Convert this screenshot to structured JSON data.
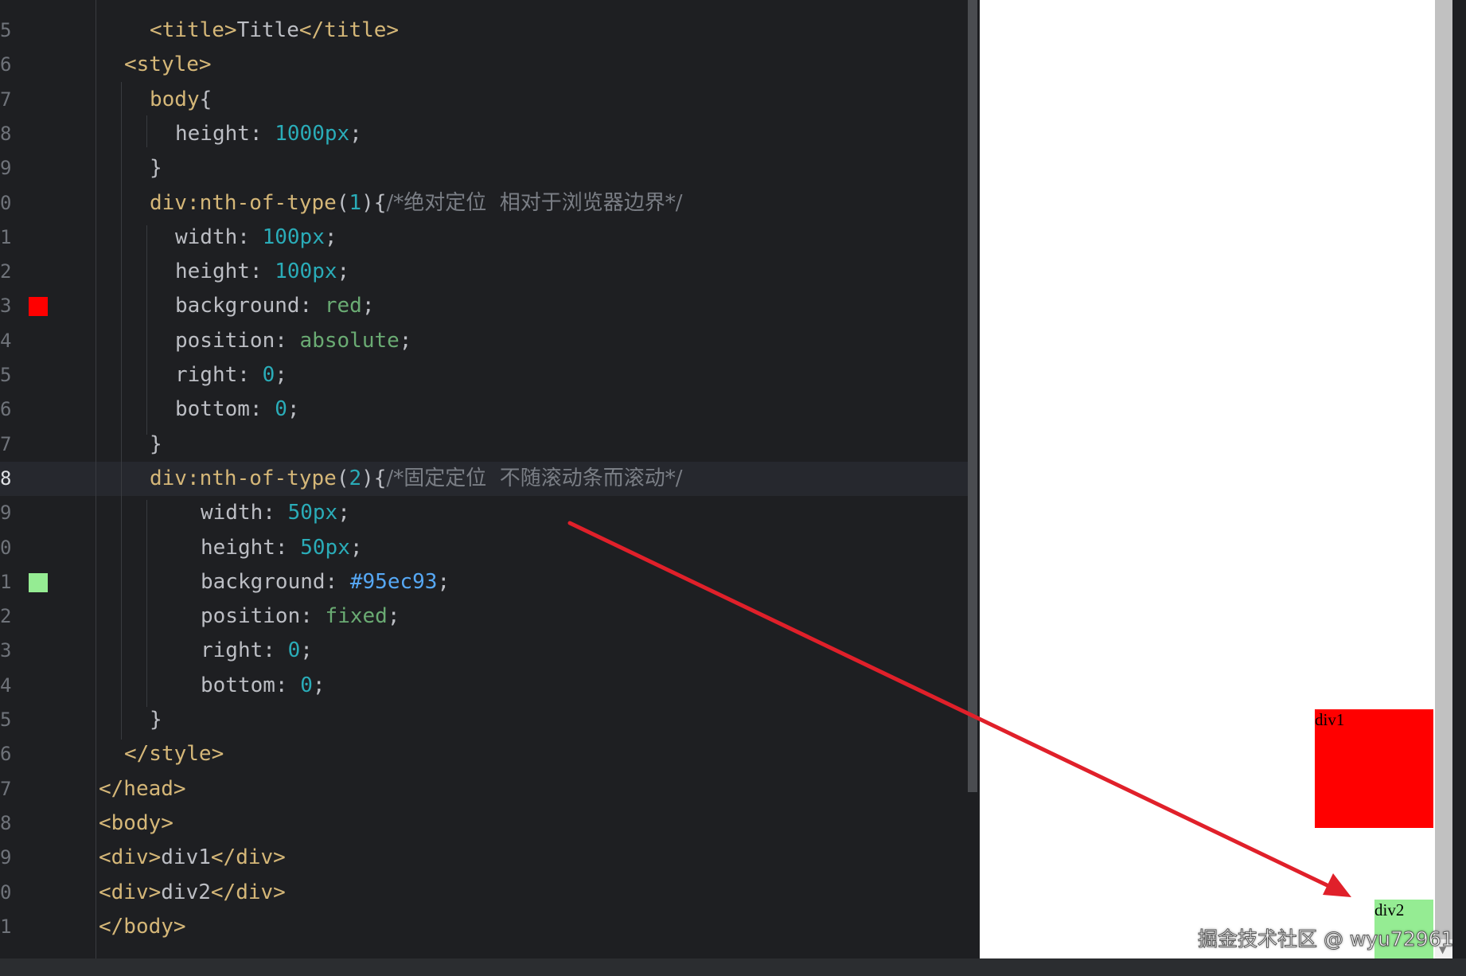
{
  "editor": {
    "lines": [
      {
        "no": "5",
        "tokens": [
          {
            "c": "tag",
            "t": "<title>"
          },
          {
            "c": "txt",
            "t": "Title"
          },
          {
            "c": "tag",
            "t": "</title>"
          }
        ],
        "indent": 188
      },
      {
        "no": "6",
        "tokens": [
          {
            "c": "tag",
            "t": "<style>"
          }
        ],
        "indent": 156
      },
      {
        "no": "7",
        "tokens": [
          {
            "c": "sel",
            "t": "body"
          },
          {
            "c": "punc",
            "t": "{"
          }
        ],
        "indent": 188
      },
      {
        "no": "8",
        "tokens": [
          {
            "c": "prop",
            "t": "height"
          },
          {
            "c": "punc",
            "t": ": "
          },
          {
            "c": "num",
            "t": "1000px"
          },
          {
            "c": "punc",
            "t": ";"
          }
        ],
        "indent": 220
      },
      {
        "no": "9",
        "tokens": [
          {
            "c": "punc",
            "t": "}"
          }
        ],
        "indent": 188
      },
      {
        "no": "0",
        "tokens": [
          {
            "c": "sel",
            "t": "div:nth-of-type"
          },
          {
            "c": "punc",
            "t": "("
          },
          {
            "c": "num",
            "t": "1"
          },
          {
            "c": "punc",
            "t": "){"
          },
          {
            "c": "cmt",
            "t": "/*绝对定位  相对于浏览器边界*/"
          }
        ],
        "indent": 188
      },
      {
        "no": "1",
        "tokens": [
          {
            "c": "prop",
            "t": "width"
          },
          {
            "c": "punc",
            "t": ": "
          },
          {
            "c": "num",
            "t": "100px"
          },
          {
            "c": "punc",
            "t": ";"
          }
        ],
        "indent": 220
      },
      {
        "no": "2",
        "tokens": [
          {
            "c": "prop",
            "t": "height"
          },
          {
            "c": "punc",
            "t": ": "
          },
          {
            "c": "num",
            "t": "100px"
          },
          {
            "c": "punc",
            "t": ";"
          }
        ],
        "indent": 220
      },
      {
        "no": "3",
        "swatch": "#ff0000",
        "tokens": [
          {
            "c": "prop",
            "t": "background"
          },
          {
            "c": "punc",
            "t": ": "
          },
          {
            "c": "kw",
            "t": "red"
          },
          {
            "c": "punc",
            "t": ";"
          }
        ],
        "indent": 220
      },
      {
        "no": "4",
        "tokens": [
          {
            "c": "prop",
            "t": "position"
          },
          {
            "c": "punc",
            "t": ": "
          },
          {
            "c": "kw",
            "t": "absolute"
          },
          {
            "c": "punc",
            "t": ";"
          }
        ],
        "indent": 220
      },
      {
        "no": "5",
        "tokens": [
          {
            "c": "prop",
            "t": "right"
          },
          {
            "c": "punc",
            "t": ": "
          },
          {
            "c": "num",
            "t": "0"
          },
          {
            "c": "punc",
            "t": ";"
          }
        ],
        "indent": 220
      },
      {
        "no": "6",
        "tokens": [
          {
            "c": "prop",
            "t": "bottom"
          },
          {
            "c": "punc",
            "t": ": "
          },
          {
            "c": "num",
            "t": "0"
          },
          {
            "c": "punc",
            "t": ";"
          }
        ],
        "indent": 220
      },
      {
        "no": "7",
        "tokens": [
          {
            "c": "punc",
            "t": "}"
          }
        ],
        "indent": 188
      },
      {
        "no": "8",
        "current": true,
        "tokens": [
          {
            "c": "sel",
            "t": "div:nth-of-type"
          },
          {
            "c": "punc",
            "t": "("
          },
          {
            "c": "num",
            "t": "2"
          },
          {
            "c": "punc",
            "t": "){"
          },
          {
            "c": "cmt",
            "t": "/*固定定位  不随滚动条而滚动*/"
          }
        ],
        "indent": 188
      },
      {
        "no": "9",
        "tokens": [
          {
            "c": "prop",
            "t": "width"
          },
          {
            "c": "punc",
            "t": ": "
          },
          {
            "c": "num",
            "t": "50px"
          },
          {
            "c": "punc",
            "t": ";"
          }
        ],
        "indent": 252
      },
      {
        "no": "0",
        "tokens": [
          {
            "c": "prop",
            "t": "height"
          },
          {
            "c": "punc",
            "t": ": "
          },
          {
            "c": "num",
            "t": "50px"
          },
          {
            "c": "punc",
            "t": ";"
          }
        ],
        "indent": 252
      },
      {
        "no": "1",
        "swatch": "#95ec93",
        "tokens": [
          {
            "c": "prop",
            "t": "background"
          },
          {
            "c": "punc",
            "t": ": "
          },
          {
            "c": "hex",
            "t": "#95ec93"
          },
          {
            "c": "punc",
            "t": ";"
          }
        ],
        "indent": 252
      },
      {
        "no": "2",
        "tokens": [
          {
            "c": "prop",
            "t": "position"
          },
          {
            "c": "punc",
            "t": ": "
          },
          {
            "c": "kw",
            "t": "fixed"
          },
          {
            "c": "punc",
            "t": ";"
          }
        ],
        "indent": 252
      },
      {
        "no": "3",
        "tokens": [
          {
            "c": "prop",
            "t": "right"
          },
          {
            "c": "punc",
            "t": ": "
          },
          {
            "c": "num",
            "t": "0"
          },
          {
            "c": "punc",
            "t": ";"
          }
        ],
        "indent": 252
      },
      {
        "no": "4",
        "tokens": [
          {
            "c": "prop",
            "t": "bottom"
          },
          {
            "c": "punc",
            "t": ": "
          },
          {
            "c": "num",
            "t": "0"
          },
          {
            "c": "punc",
            "t": ";"
          }
        ],
        "indent": 252
      },
      {
        "no": "5",
        "tokens": [
          {
            "c": "punc",
            "t": "}"
          }
        ],
        "indent": 188
      },
      {
        "no": "6",
        "tokens": [
          {
            "c": "tag",
            "t": "</style>"
          }
        ],
        "indent": 156
      },
      {
        "no": "7",
        "tokens": [
          {
            "c": "tag",
            "t": "</head>"
          }
        ],
        "indent": 124
      },
      {
        "no": "8",
        "tokens": [
          {
            "c": "tag",
            "t": "<body>"
          }
        ],
        "indent": 124
      },
      {
        "no": "9",
        "tokens": [
          {
            "c": "tag",
            "t": "<div>"
          },
          {
            "c": "txt",
            "t": "div1"
          },
          {
            "c": "tag",
            "t": "</div>"
          }
        ],
        "indent": 124
      },
      {
        "no": "0",
        "tokens": [
          {
            "c": "tag",
            "t": "<div>"
          },
          {
            "c": "txt",
            "t": "div2"
          },
          {
            "c": "tag",
            "t": "</div>"
          }
        ],
        "indent": 124
      },
      {
        "no": "1",
        "tokens": [
          {
            "c": "tag",
            "t": "</body>"
          }
        ],
        "indent": 124
      }
    ]
  },
  "preview": {
    "div1_text": "div1",
    "div2_text": "div2",
    "div1_color": "#ff0000",
    "div2_color": "#95ec93"
  },
  "watermark": "掘金技术社区 @ wyu72961",
  "arrow_color": "#e0202a"
}
